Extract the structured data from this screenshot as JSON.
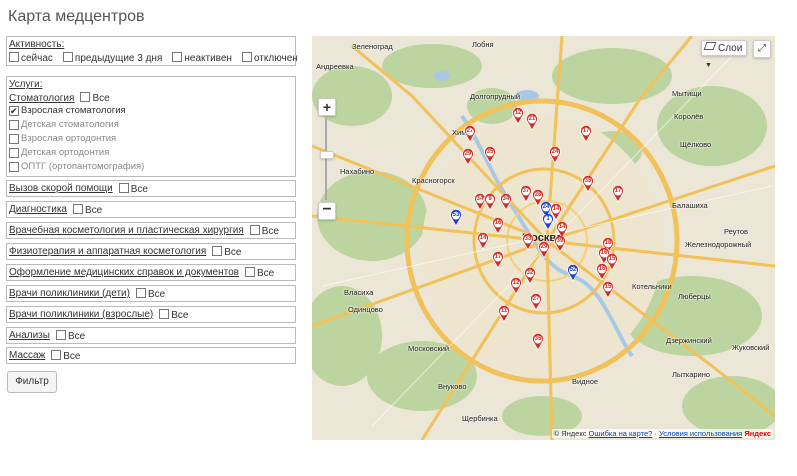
{
  "page_title": "Карта медцентров",
  "activity": {
    "label": "Активность:",
    "options": [
      "сейчас",
      "предыдущие 3 дня",
      "неактивен",
      "отключен"
    ]
  },
  "services_label": "Услуги:",
  "all_label": "Все",
  "dentistry": {
    "label": "Стоматология",
    "items": [
      {
        "label": "Взрослая стоматология",
        "checked": true
      },
      {
        "label": "Детская стоматология",
        "checked": false
      },
      {
        "label": "Взрослая ортодонтия",
        "checked": false
      },
      {
        "label": "Детская ортодонтия",
        "checked": false
      },
      {
        "label": "ОПТГ (ортопантомография)",
        "checked": false
      }
    ]
  },
  "categories": [
    "Вызов скорой помощи",
    "Диагностика",
    "Врачебная косметология и пластическая хирургия",
    "Физиотерапия и аппаратная косметология",
    "Оформление медицинских справок и документов",
    "Врачи поликлиники (дети)",
    "Врачи поликлиники (взрослые)",
    "Анализы",
    "Массаж"
  ],
  "filter_button": "Фильтр",
  "map": {
    "layers_button": "Слои",
    "attribution": "© Яндекс",
    "error_link": "Ошибка на карте?",
    "terms_link": "Условия использования",
    "logo": "Яндекс",
    "red_color": "#d12c24",
    "blue_color": "#1e3ed6",
    "places": [
      "Лобня",
      "Зеленоград",
      "Андреевка",
      "Долгопрудный",
      "Химки",
      "Мытищи",
      "Королёв",
      "Щёлково",
      "Красногорск",
      "Нахабино",
      "Москва",
      "Балашиха",
      "Реутов",
      "Железнодорожный",
      "Люберцы",
      "Власиха",
      "Одинцово",
      "Московский",
      "Дзержинский",
      "Видное",
      "Щербинка",
      "Жуковский",
      "Лыткарино",
      "Котельники",
      "Внуково"
    ],
    "markers": [
      {
        "n": "12",
        "c": "red"
      },
      {
        "n": "21",
        "c": "red"
      },
      {
        "n": "27",
        "c": "red"
      },
      {
        "n": "29",
        "c": "red"
      },
      {
        "n": "35",
        "c": "red"
      },
      {
        "n": "24",
        "c": "red"
      },
      {
        "n": "17",
        "c": "red"
      },
      {
        "n": "35",
        "c": "red"
      },
      {
        "n": "17",
        "c": "red"
      },
      {
        "n": "34",
        "c": "red"
      },
      {
        "n": "9",
        "c": "red"
      },
      {
        "n": "34",
        "c": "red"
      },
      {
        "n": "37",
        "c": "red"
      },
      {
        "n": "28",
        "c": "red"
      },
      {
        "n": "24",
        "c": "blue"
      },
      {
        "n": "1",
        "c": "blue"
      },
      {
        "n": "14",
        "c": "red"
      },
      {
        "n": "53",
        "c": "blue"
      },
      {
        "n": "16",
        "c": "red"
      },
      {
        "n": "14",
        "c": "red"
      },
      {
        "n": "33",
        "c": "red"
      },
      {
        "n": "14",
        "c": "red"
      },
      {
        "n": "39",
        "c": "red"
      },
      {
        "n": "29",
        "c": "red"
      },
      {
        "n": "18",
        "c": "red"
      },
      {
        "n": "16",
        "c": "red"
      },
      {
        "n": "15",
        "c": "red"
      },
      {
        "n": "17",
        "c": "red"
      },
      {
        "n": "32",
        "c": "red"
      },
      {
        "n": "52",
        "c": "blue"
      },
      {
        "n": "16",
        "c": "red"
      },
      {
        "n": "12",
        "c": "red"
      },
      {
        "n": "15",
        "c": "red"
      },
      {
        "n": "27",
        "c": "red"
      },
      {
        "n": "11",
        "c": "red"
      },
      {
        "n": "35",
        "c": "red"
      }
    ]
  }
}
